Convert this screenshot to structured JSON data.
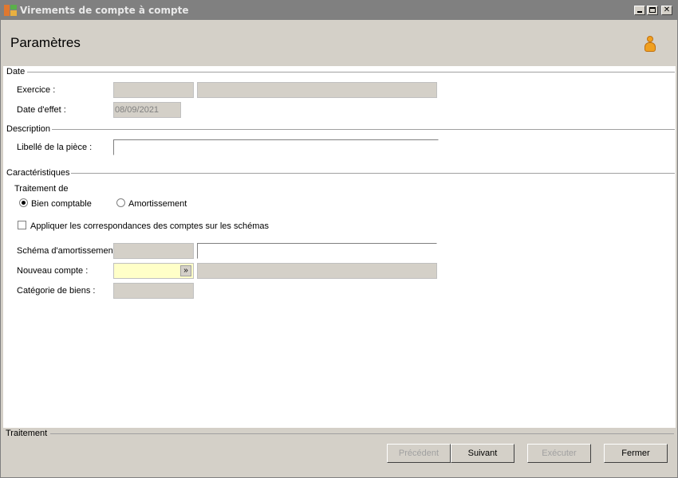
{
  "window": {
    "title": "Virements de compte à compte",
    "minimize_glyph": "_",
    "maximize_glyph": "□",
    "close_glyph": "✕"
  },
  "header": {
    "title": "Paramètres",
    "user_icon": "user-icon"
  },
  "sections": {
    "date": {
      "label": "Date",
      "exercice_label": "Exercice :",
      "exercice_code": "",
      "exercice_desc": "",
      "date_effet_label": "Date d'effet :",
      "date_effet_value": "08/09/2021"
    },
    "description": {
      "label": "Description",
      "libelle_label": "Libellé de la pièce :",
      "libelle_value": ""
    },
    "caracteristiques": {
      "label": "Caractéristiques",
      "traitement_de_label": "Traitement de",
      "radio_bien_label": "Bien comptable",
      "radio_bien_checked": true,
      "radio_amort_label": "Amortissement",
      "radio_amort_checked": false,
      "checkbox_label": "Appliquer les correspondances des comptes sur les schémas",
      "checkbox_checked": false,
      "schema_label": "Schéma d'amortissement",
      "schema_code": "",
      "schema_desc": "",
      "nouveau_compte_label": "Nouveau compte :",
      "nouveau_compte_value": "",
      "nouveau_compte_desc": "",
      "dropdown_icon": "double-chevron-down-icon",
      "categorie_label": "Catégorie de biens :",
      "categorie_value": ""
    }
  },
  "footer": {
    "label": "Traitement",
    "buttons": {
      "precedent": "Précédent",
      "suivant": "Suivant",
      "executer": "Exécuter",
      "fermer": "Fermer"
    }
  },
  "colors": {
    "titlebar": "#808080",
    "required_field": "#ffffc8",
    "user_icon": "#f0a020"
  }
}
